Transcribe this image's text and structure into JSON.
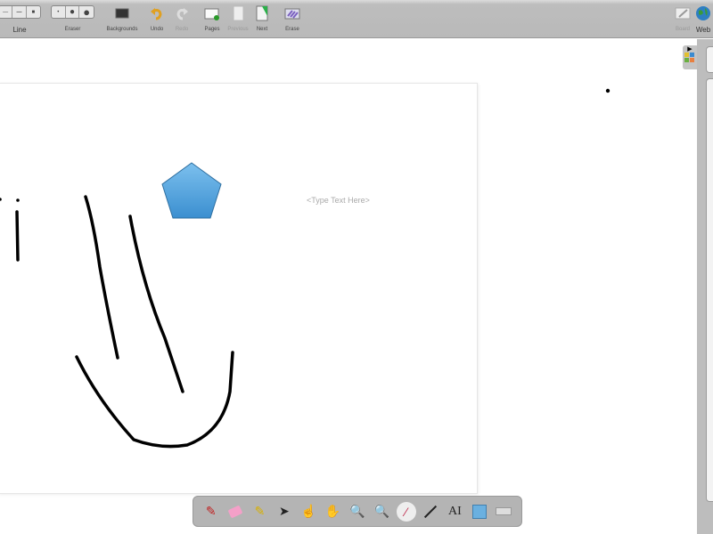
{
  "toolbar": {
    "line_label": "Line",
    "eraser_label": "Eraser",
    "backgrounds_label": "Backgrounds",
    "undo_label": "Undo",
    "redo_label": "Redo",
    "pages_label": "Pages",
    "previous_label": "Previous",
    "next_label": "Next",
    "erase_label": "Erase",
    "board_label": "Board",
    "web_label": "Web"
  },
  "canvas": {
    "text_placeholder": "<Type Text Here>",
    "shape_color": "#5aabe0"
  },
  "dock": {
    "tools": [
      "pen",
      "eraser",
      "marker",
      "selector",
      "pointer-hand",
      "pan-hand",
      "zoom-in",
      "zoom-out",
      "laser-pointer",
      "line",
      "text",
      "capture",
      "virtual-keyboard"
    ],
    "text_tool_label": "AI"
  }
}
